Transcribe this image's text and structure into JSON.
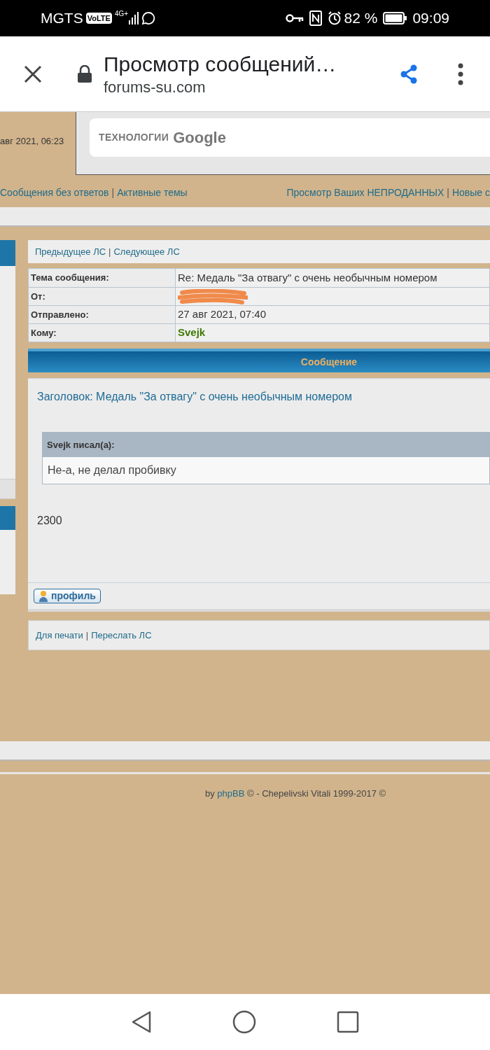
{
  "status_bar": {
    "carrier": "MGTS",
    "volte": "VoLTE",
    "network": "4G+",
    "battery_percent": "82 %",
    "time": "09:09"
  },
  "browser": {
    "title": "Просмотр сообщений…",
    "domain": "forums-su.com"
  },
  "header": {
    "date_fragment": "авг 2021, 06:23",
    "ad_text": "ТЕХНОЛОГИИ",
    "ad_brand": "Google"
  },
  "nav": {
    "separator": "|",
    "left": [
      "Сообщения без ответов",
      "Активные темы"
    ],
    "right": [
      "Просмотр Ваших НЕПРОДАННЫХ",
      "Новые с"
    ]
  },
  "pm_nav": {
    "separator": "|",
    "links": [
      "Предыдущее ЛС",
      "Следующее ЛС"
    ]
  },
  "details": [
    {
      "label": "Тема сообщения:",
      "value": "Re: Медаль \"За отвагу\" с очень необычным номером",
      "kind": "text"
    },
    {
      "label": "От:",
      "kind": "redacted"
    },
    {
      "label": "Отправлено:",
      "value": "27 авг 2021, 07:40",
      "kind": "text"
    },
    {
      "label": "Кому:",
      "value": "Svejk",
      "kind": "user"
    }
  ],
  "message": {
    "header": "Сообщение",
    "subject": "Заголовок: Медаль \"За отвагу\" с очень необычным номером",
    "quote_author": "Svejk писал(а):",
    "quote_text": "Не-а, не делал пробивку",
    "body": "2300",
    "profile_button": "профиль"
  },
  "actions": {
    "separator": "|",
    "links": [
      "Для печати",
      "Переслать ЛС"
    ]
  },
  "footer": {
    "prefix": "by",
    "link": "phpBB",
    "suffix": "© - Chepelivski Vitali 1999-2017 ©"
  }
}
